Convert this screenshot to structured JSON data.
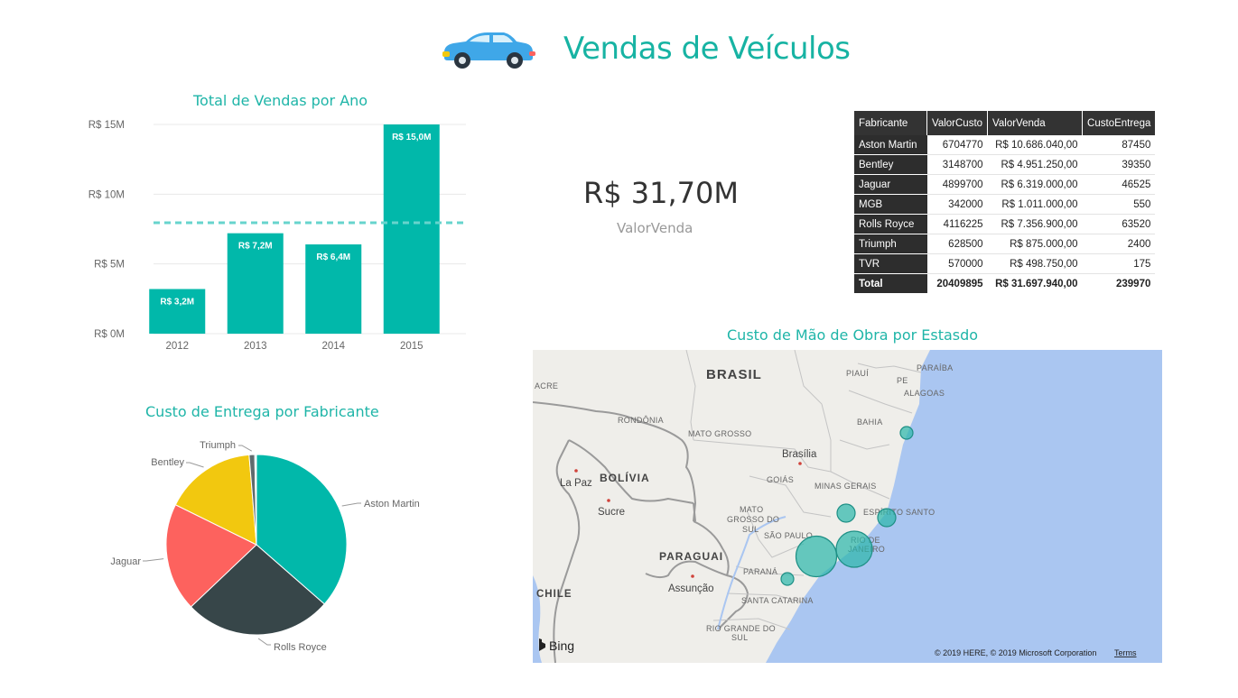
{
  "header": {
    "title": "Vendas de Veículos",
    "icon": "car-icon"
  },
  "bar_chart_title": "Total de Vendas por Ano",
  "kpi": {
    "value": "R$ 31,70M",
    "label": "ValorVenda"
  },
  "pie_chart_title": "Custo de Entrega por Fabricante",
  "map_title": "Custo de Mão de Obra por Estasdo",
  "table": {
    "columns": [
      "Fabricante",
      "ValorCusto",
      "ValorVenda",
      "CustoEntrega"
    ],
    "rows": [
      [
        "Aston Martin",
        "6704770",
        "R$ 10.686.040,00",
        "87450"
      ],
      [
        "Bentley",
        "3148700",
        "R$ 4.951.250,00",
        "39350"
      ],
      [
        "Jaguar",
        "4899700",
        "R$ 6.319.000,00",
        "46525"
      ],
      [
        "MGB",
        "342000",
        "R$ 1.011.000,00",
        "550"
      ],
      [
        "Rolls Royce",
        "4116225",
        "R$ 7.356.900,00",
        "63520"
      ],
      [
        "Triumph",
        "628500",
        "R$ 875.000,00",
        "2400"
      ],
      [
        "TVR",
        "570000",
        "R$ 498.750,00",
        "175"
      ]
    ],
    "total": [
      "Total",
      "20409895",
      "R$ 31.697.940,00",
      "239970"
    ]
  },
  "map": {
    "country_labels": [
      "BRASIL",
      "BOLÍVIA",
      "PARAGUAI",
      "CHILE"
    ],
    "region_labels": [
      "ACRE",
      "RONDÔNIA",
      "MATO GROSSO",
      "PIAUÍ",
      "PE",
      "PARAÍBA",
      "ALAGOAS",
      "BAHIA",
      "GOIÁS",
      "MINAS GERAIS",
      "ESPÍRITO SANTO",
      "MATO",
      "GROSSO DO",
      "SUL",
      "SÃO PAULO",
      "RIO DE",
      "JANEIRO",
      "PARANÁ",
      "SANTA CATARINA",
      "RIO GRANDE DO",
      "SUL"
    ],
    "city_labels": [
      "Brasília",
      "La Paz",
      "Sucre",
      "Assunção"
    ],
    "bing_label": "Bing",
    "copyright": "© 2019 HERE, © 2019 Microsoft Corporation",
    "terms_label": "Terms",
    "bubble_color": "#2ab7a9"
  },
  "chart_data": [
    {
      "type": "bar",
      "title": "Total de Vendas por Ano",
      "categories": [
        "2012",
        "2013",
        "2014",
        "2015"
      ],
      "values": [
        3.2,
        7.2,
        6.4,
        15.0
      ],
      "value_labels": [
        "R$ 3,2M",
        "R$ 7,2M",
        "R$ 6,4M",
        "R$ 15,0M"
      ],
      "ytick_labels": [
        "R$ 0M",
        "R$ 5M",
        "R$ 10M",
        "R$ 15M"
      ],
      "ylim": [
        0,
        15
      ],
      "average_line": 7.95,
      "color": "#01b8aa",
      "average_color": "#67d4cd",
      "grid": true
    },
    {
      "type": "pie",
      "title": "Custo de Entrega por Fabricante",
      "labels": [
        "Aston Martin",
        "Rolls Royce",
        "Jaguar",
        "Bentley",
        "Triumph",
        "MGB",
        "TVR"
      ],
      "values": [
        87450,
        63520,
        46525,
        39350,
        2400,
        550,
        175
      ],
      "colors": [
        "#01b8aa",
        "#374649",
        "#fd625e",
        "#f2c80f",
        "#5f6b6d",
        "#8ad4eb",
        "#fe9666"
      ],
      "labeled": [
        "Aston Martin",
        "Rolls Royce",
        "Jaguar",
        "Bentley",
        "Triumph"
      ]
    }
  ]
}
